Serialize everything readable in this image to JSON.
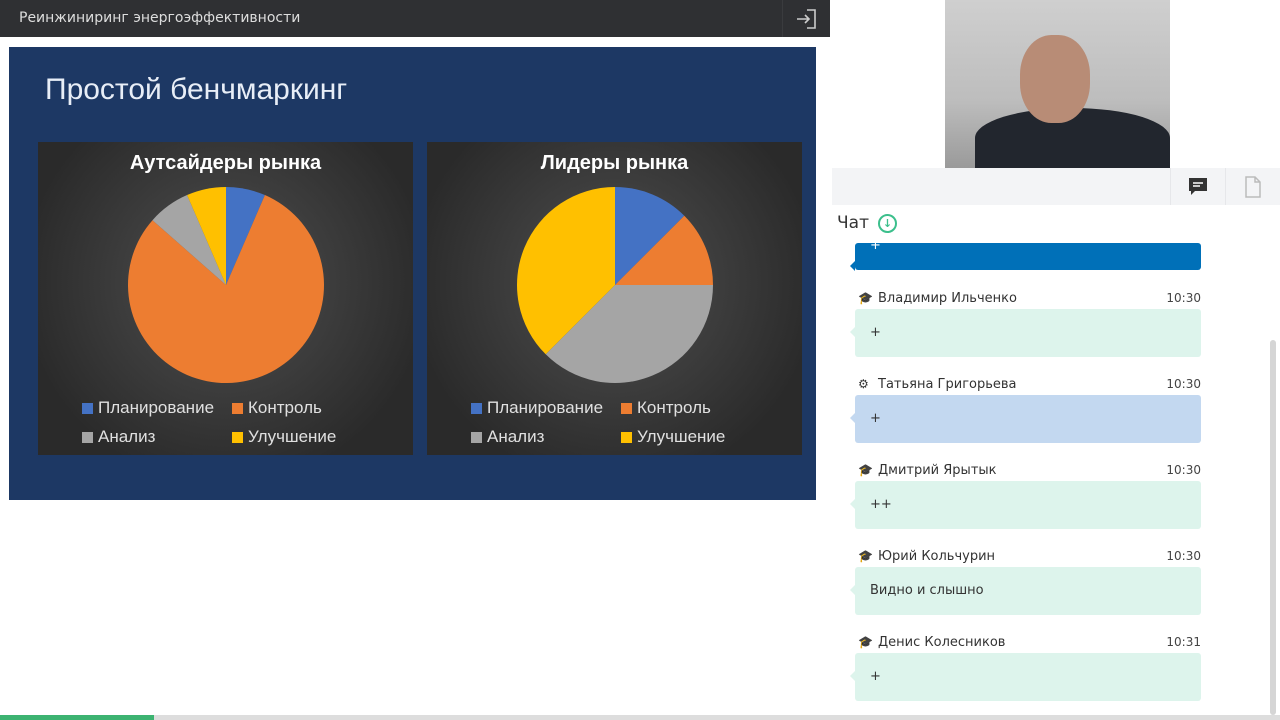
{
  "header": {
    "title": "Реинжиниринг энергоэффективности",
    "exit_icon": "exit-icon"
  },
  "slide": {
    "title": "Простой бенчмаркинг"
  },
  "chart_data": [
    {
      "type": "pie",
      "title": "Аутсайдеры рынка",
      "categories": [
        "Планирование",
        "Контроль",
        "Анализ",
        "Улучшение"
      ],
      "values": [
        6.5,
        80,
        7,
        6.5
      ],
      "colors": [
        "#4472c4",
        "#ed7d31",
        "#a5a5a5",
        "#ffc000"
      ],
      "legend": "bottom"
    },
    {
      "type": "pie",
      "title": "Лидеры рынка",
      "categories": [
        "Планирование",
        "Контроль",
        "Анализ",
        "Улучшение"
      ],
      "values": [
        12.5,
        12.5,
        37.5,
        37.5
      ],
      "colors": [
        "#4472c4",
        "#ed7d31",
        "#a5a5a5",
        "#ffc000"
      ],
      "legend": "bottom"
    }
  ],
  "chat": {
    "title": "Чат",
    "first_msg": "+",
    "messages": [
      {
        "name": "Владимир Ильченко",
        "time": "10:30",
        "text": "+",
        "role": "student"
      },
      {
        "name": "Татьяна Григорьева",
        "time": "10:30",
        "text": "+",
        "role": "moderator"
      },
      {
        "name": "Дмитрий Ярытык",
        "time": "10:30",
        "text": "++",
        "role": "student"
      },
      {
        "name": "Юрий Кольчурин",
        "time": "10:30",
        "text": "Видно и слышно",
        "role": "student"
      },
      {
        "name": "Денис Колесников",
        "time": "10:31",
        "text": "+",
        "role": "student"
      }
    ]
  },
  "progress": {
    "percent": 12
  }
}
